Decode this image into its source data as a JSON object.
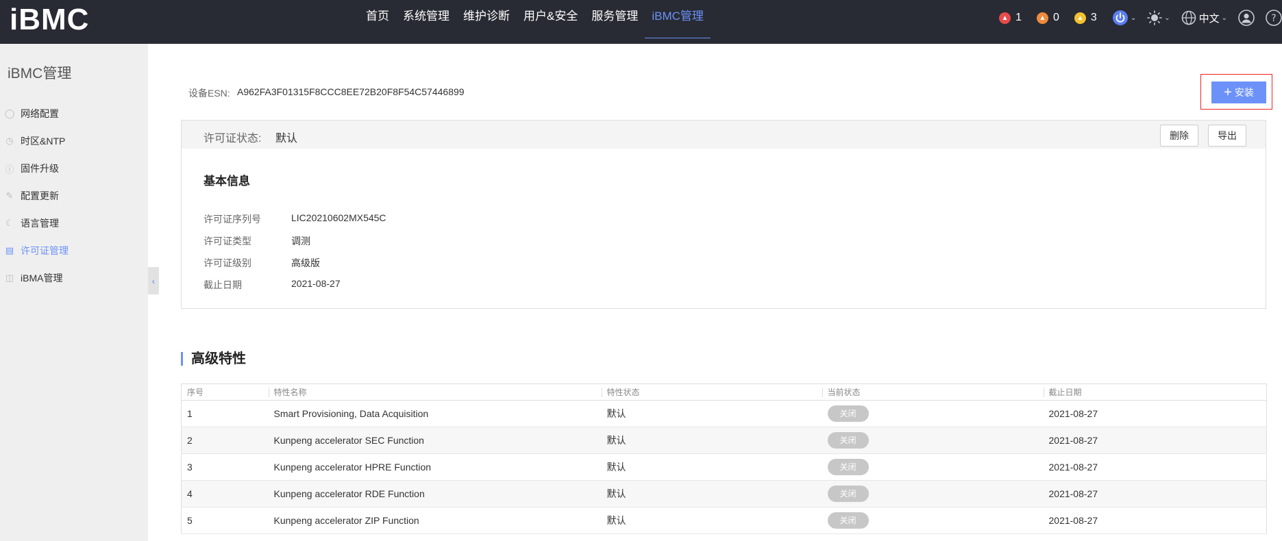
{
  "app": {
    "logo": "iBMC"
  },
  "nav": [
    {
      "label": "首页"
    },
    {
      "label": "系统管理"
    },
    {
      "label": "维护诊断"
    },
    {
      "label": "用户&安全"
    },
    {
      "label": "服务管理"
    },
    {
      "label": "iBMC管理",
      "active": true
    }
  ],
  "alarms": {
    "critical": {
      "count": "1",
      "color": "#e94b4b"
    },
    "major": {
      "count": "0",
      "color": "#f08a3c"
    },
    "minor": {
      "count": "3",
      "color": "#f2c230"
    }
  },
  "top_icons": {
    "power": "power-icon",
    "brightness": "brightness-icon",
    "language": "globe-icon",
    "language_label": "中文",
    "user": "user-icon",
    "help": "help-icon"
  },
  "sidebar": {
    "title": "iBMC管理",
    "items": [
      {
        "label": "网络配置",
        "icon": "network-icon"
      },
      {
        "label": "时区&NTP",
        "icon": "clock-icon"
      },
      {
        "label": "固件升级",
        "icon": "upgrade-icon"
      },
      {
        "label": "配置更新",
        "icon": "config-icon"
      },
      {
        "label": "语言管理",
        "icon": "language-icon"
      },
      {
        "label": "许可证管理",
        "icon": "license-icon",
        "active": true
      },
      {
        "label": "iBMA管理",
        "icon": "ibma-icon"
      }
    ]
  },
  "esn": {
    "label": "设备ESN:",
    "value": "A962FA3F01315F8CCC8EE72B20F8F54C57446899"
  },
  "install_button": {
    "label": "安装"
  },
  "license": {
    "status_label": "许可证状态:",
    "status_value": "默认",
    "delete_label": "删除",
    "export_label": "导出",
    "basic_title": "基本信息",
    "info": [
      {
        "label": "许可证序列号",
        "value": "LIC20210602MX545C"
      },
      {
        "label": "许可证类型",
        "value": "调测"
      },
      {
        "label": "许可证级别",
        "value": "高级版"
      },
      {
        "label": "截止日期",
        "value": "2021-08-27"
      }
    ]
  },
  "features": {
    "title": "高级特性",
    "columns": [
      "序号",
      "特性名称",
      "特性状态",
      "当前状态",
      "截止日期"
    ],
    "rows": [
      {
        "no": "1",
        "name": "Smart Provisioning, Data Acquisition",
        "status": "默认",
        "current": "关闭",
        "expiry": "2021-08-27"
      },
      {
        "no": "2",
        "name": "Kunpeng accelerator SEC Function",
        "status": "默认",
        "current": "关闭",
        "expiry": "2021-08-27"
      },
      {
        "no": "3",
        "name": "Kunpeng accelerator HPRE Function",
        "status": "默认",
        "current": "关闭",
        "expiry": "2021-08-27"
      },
      {
        "no": "4",
        "name": "Kunpeng accelerator RDE Function",
        "status": "默认",
        "current": "关闭",
        "expiry": "2021-08-27"
      },
      {
        "no": "5",
        "name": "Kunpeng accelerator ZIP Function",
        "status": "默认",
        "current": "关闭",
        "expiry": "2021-08-27"
      }
    ]
  },
  "colors": {
    "accent": "#6c92fa",
    "topbar": "#282b33",
    "sidebar": "#efefef",
    "highlight_box": "#e22222"
  }
}
